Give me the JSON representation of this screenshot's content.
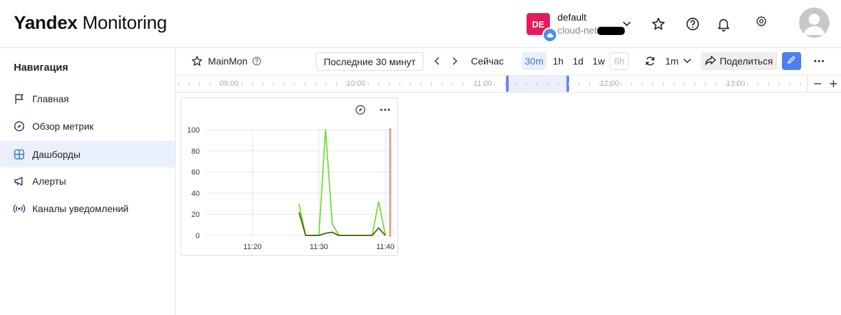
{
  "header": {
    "logo_bold": "Yandex",
    "logo_light": "Monitoring",
    "account": {
      "badge": "DE",
      "name": "default",
      "cloud": "cloud-net"
    }
  },
  "sidebar": {
    "title": "Навигация",
    "items": [
      {
        "label": "Главная",
        "icon": "flag-icon"
      },
      {
        "label": "Обзор метрик",
        "icon": "compass-icon"
      },
      {
        "label": "Дашборды",
        "icon": "dashboard-icon",
        "active": true
      },
      {
        "label": "Алерты",
        "icon": "megaphone-icon"
      },
      {
        "label": "Каналы уведомлений",
        "icon": "broadcast-icon"
      }
    ]
  },
  "toolbar": {
    "dashboard_name": "MainMon",
    "time_range": "Последние 30 минут",
    "now_label": "Сейчас",
    "ranges": [
      "30m",
      "1h",
      "1d",
      "1w",
      "6h"
    ],
    "active_range": "30m",
    "disabled_range": "6h",
    "refresh_interval": "1m",
    "share_label": "Поделиться"
  },
  "timeline": {
    "labels": [
      "09:00",
      "10:00",
      "11:00",
      "12:00",
      "13:00"
    ]
  },
  "colors": {
    "accent": "#4d7ff1",
    "active_bg": "#e9effb",
    "series_light": "#6fdc3a",
    "series_dark": "#4a5d0e",
    "now_marker": "#f28b82"
  },
  "chart_data": {
    "type": "line",
    "title": "",
    "xlabel": "",
    "ylabel": "",
    "ylim": [
      0,
      100
    ],
    "yticks": [
      "100",
      "80",
      "60",
      "40",
      "20",
      "0"
    ],
    "xticks": [
      "11:20",
      "11:30",
      "11:40"
    ],
    "x": [
      "11:27",
      "11:28",
      "11:29",
      "11:30",
      "11:31",
      "11:32",
      "11:33",
      "11:34",
      "11:35",
      "11:36",
      "11:37",
      "11:38",
      "11:39",
      "11:40"
    ],
    "series": [
      {
        "values": [
          30,
          0,
          0,
          0,
          100,
          11,
          0,
          0,
          0,
          0,
          0,
          0,
          32,
          0
        ]
      },
      {
        "values": [
          22,
          0,
          0,
          0,
          2,
          3,
          0,
          0,
          0,
          0,
          0,
          0,
          7,
          0
        ]
      }
    ]
  }
}
